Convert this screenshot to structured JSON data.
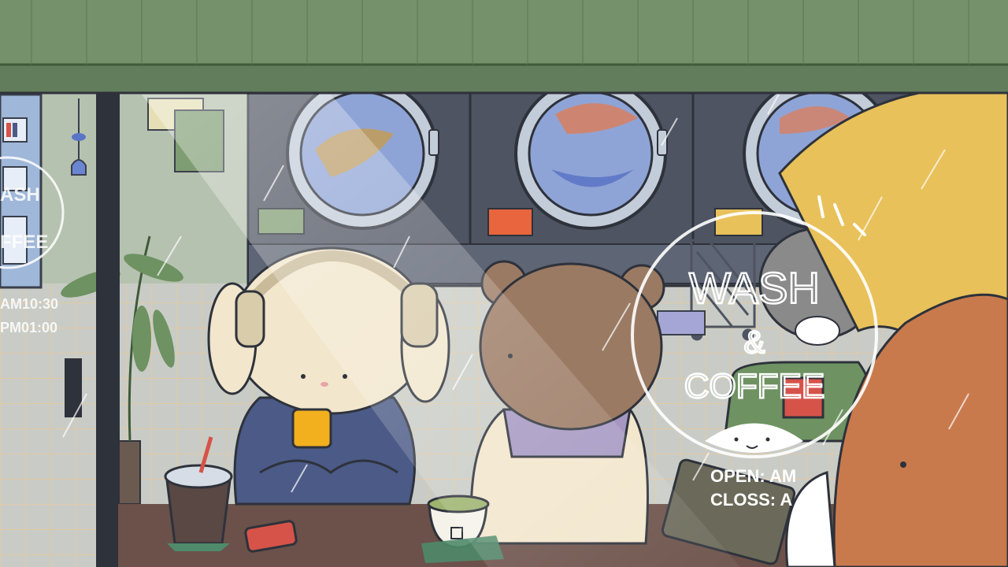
{
  "window_sign": {
    "title_line1": "WASH",
    "title_amp": "&",
    "title_line2": "COFFEE",
    "open_label": "OPEN: AM",
    "close_label": "CLOSS: A"
  },
  "side_sign": {
    "time1": "AM10:30",
    "time2": "PM01:00",
    "fragment_top": "ASH",
    "fragment_bottom": "FFEE"
  },
  "colors": {
    "awning": "#74916b",
    "washer_body": "#4e5461",
    "washer_glass": "#8fa4d6",
    "floor_tile": "#c9ccc6",
    "table": "#6b5149",
    "umbrella": "#e8c15a",
    "fox": "#c97a4d",
    "bunny_fur": "#f2e6cc",
    "bear_fur": "#9b7a63",
    "cat_fur": "#8a8a8a",
    "hoodie": "#4b5a86",
    "rain": "#ffffff"
  },
  "icons": [
    "headphones-icon",
    "phone-icon",
    "fish-charm-icon",
    "wind-chime-icon",
    "laundry-cart-icon",
    "plant-icon",
    "tea-bag-icon",
    "straw-icon"
  ]
}
